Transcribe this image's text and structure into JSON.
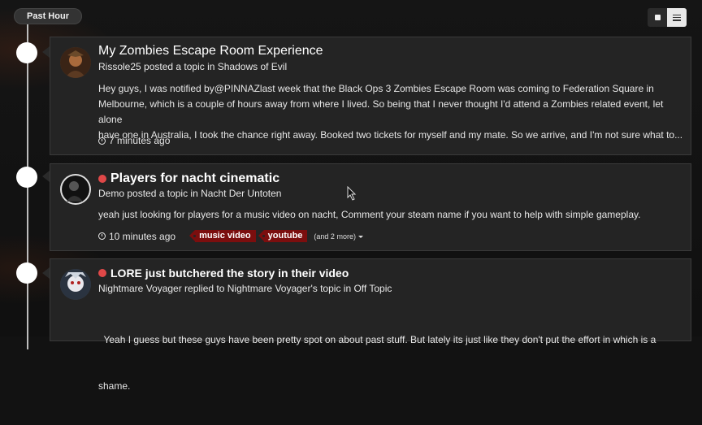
{
  "header": {
    "period_label": "Past Hour",
    "view_options": [
      "grid",
      "list"
    ],
    "active_view": "list"
  },
  "colors": {
    "unread_dot": "#e04848",
    "tag_bg": "#7b0e0e",
    "card_bg": "#242424"
  },
  "activities": [
    {
      "title": "My Zombies Escape Room Experience",
      "unread": false,
      "meta": "Rissole25 posted a topic in Shadows of Evil",
      "snippet_lines": [
        "Hey guys, I was notified by@PINNAZlast week that the Black Ops 3 Zombies Escape Room was coming to Federation Square in",
        "Melbourne, which is a couple of hours away from where I lived. So being that I never thought I'd attend a Zombies related event, let alone",
        "have one in Australia, I took the chance right away. Booked two tickets for myself and my mate.   So we arrive, and I'm not sure what to..."
      ],
      "time": "7 minutes ago"
    },
    {
      "title": "Players for nacht cinematic",
      "unread": true,
      "meta": "Demo posted a topic in Nacht Der Untoten",
      "snippet_lines": [
        "yeah just looking for players for a music video on nacht, Comment your steam name if you want to help with simple gameplay."
      ],
      "time": "10 minutes ago",
      "tags": [
        "music video",
        "youtube"
      ],
      "more_tags": "(and 2 more)"
    },
    {
      "title": "LORE just butchered the story in their video",
      "unread": true,
      "meta": "Nightmare Voyager replied to Nightmare Voyager's topic in Off Topic",
      "snippet_lines": [
        "  Yeah I guess but these guys have been pretty spot on about past stuff. But lately its just like they don't put the effort in which is a",
        "shame."
      ]
    }
  ]
}
